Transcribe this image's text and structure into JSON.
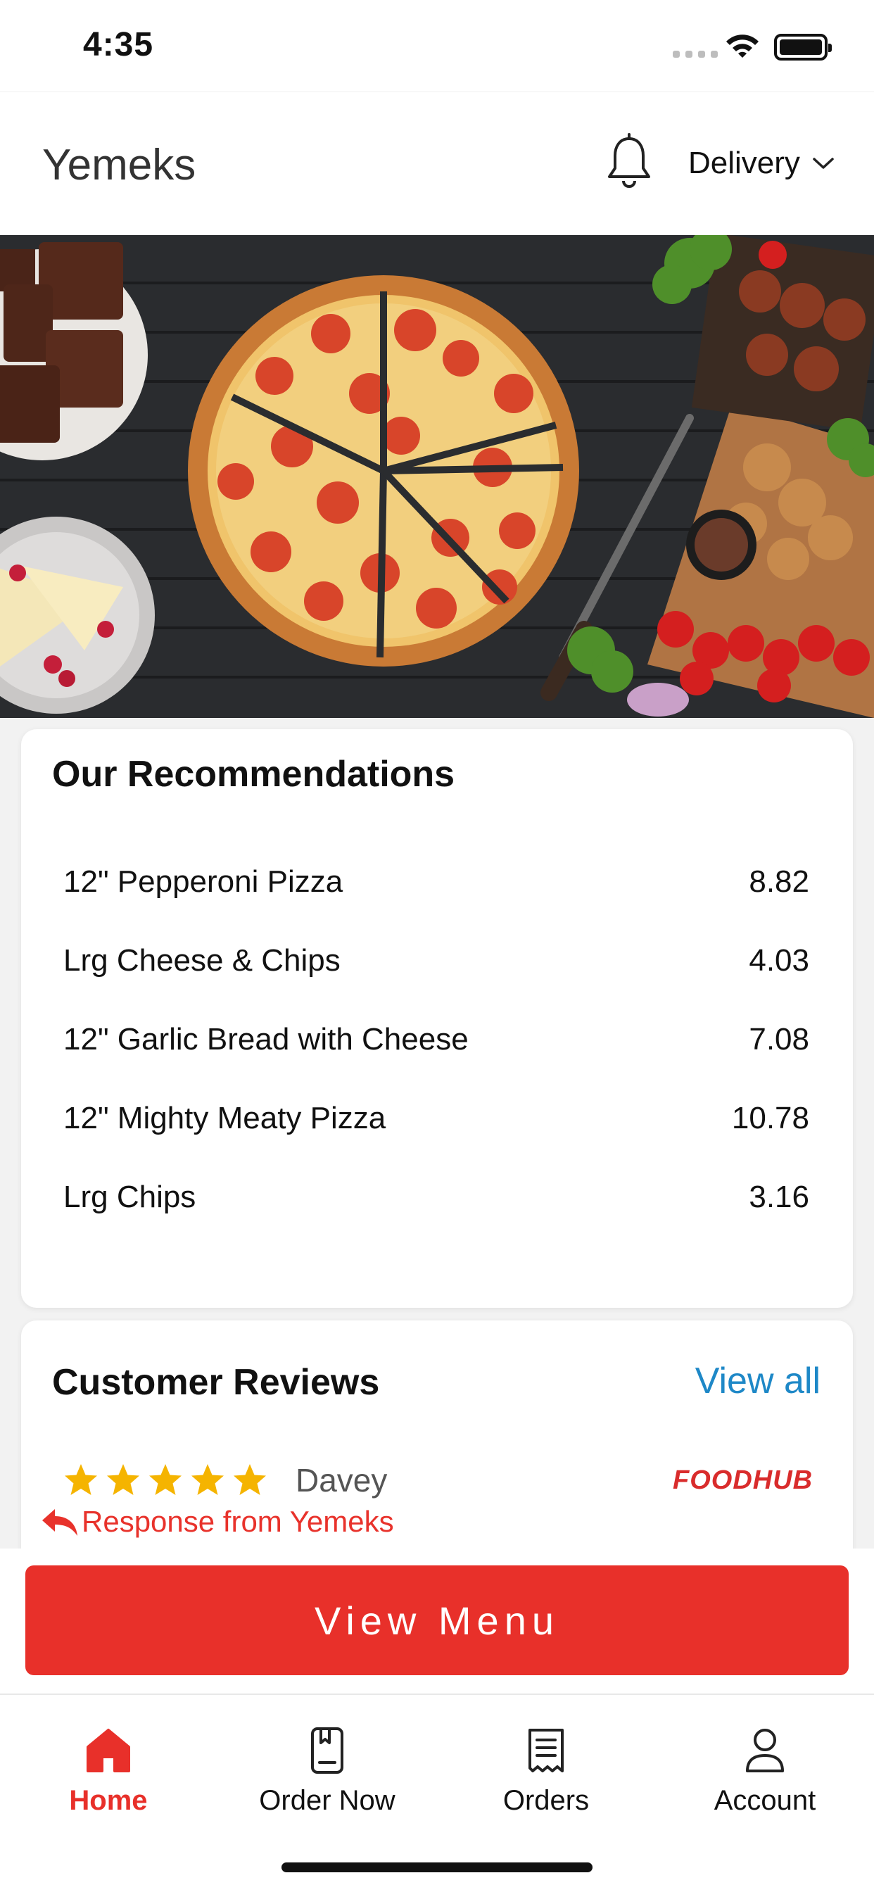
{
  "status_bar": {
    "time": "4:35"
  },
  "header": {
    "title": "Yemeks",
    "delivery_label": "Delivery"
  },
  "recommendations": {
    "title": "Our Recommendations",
    "items": [
      {
        "name": "12\" Pepperoni Pizza",
        "price": "8.82"
      },
      {
        "name": "Lrg Cheese & Chips",
        "price": "4.03"
      },
      {
        "name": "12\" Garlic Bread with Cheese",
        "price": "7.08"
      },
      {
        "name": "12\" Mighty Meaty Pizza",
        "price": "10.78"
      },
      {
        "name": "Lrg Chips",
        "price": "3.16"
      }
    ]
  },
  "reviews": {
    "title": "Customer Reviews",
    "view_all": "View all",
    "rating": 5,
    "reviewer": "Davey",
    "source_logo": "FOODHUB",
    "response_label": "Response from Yemeks"
  },
  "cta": {
    "label": "View Menu"
  },
  "tabs": [
    {
      "label": "Home",
      "icon": "home-icon",
      "active": true
    },
    {
      "label": "Order Now",
      "icon": "order-now-icon",
      "active": false
    },
    {
      "label": "Orders",
      "icon": "orders-icon",
      "active": false
    },
    {
      "label": "Account",
      "icon": "account-icon",
      "active": false
    }
  ],
  "colors": {
    "accent": "#e8302a",
    "link": "#1e88c7",
    "star": "#f5b400"
  }
}
